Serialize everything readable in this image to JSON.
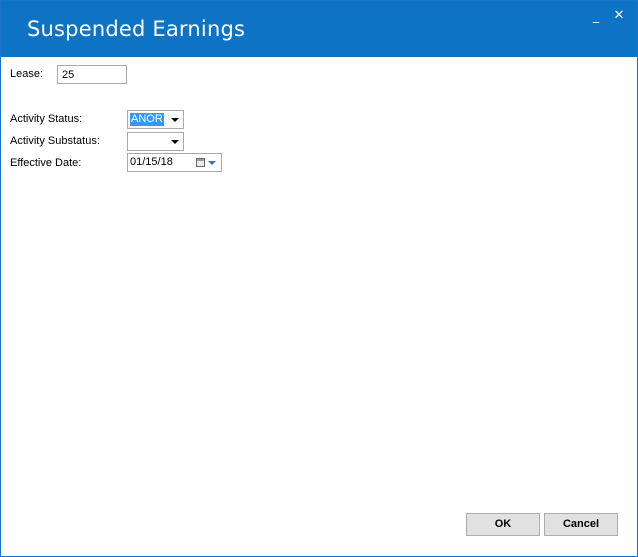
{
  "window": {
    "title": "Suspended Earnings",
    "minimize_glyph": "_",
    "close_glyph": "✕",
    "accent_color": "#0d74c5"
  },
  "form": {
    "lease": {
      "label": "Lease:",
      "value": "25"
    },
    "activity_status": {
      "label": "Activity Status:",
      "value": "ANOR"
    },
    "activity_substatus": {
      "label": "Activity Substatus:",
      "value": ""
    },
    "effective_date": {
      "label": "Effective Date:",
      "value": "01/15/18",
      "icon": "calendar-icon"
    }
  },
  "buttons": {
    "ok_label": "OK",
    "cancel_label": "Cancel"
  }
}
